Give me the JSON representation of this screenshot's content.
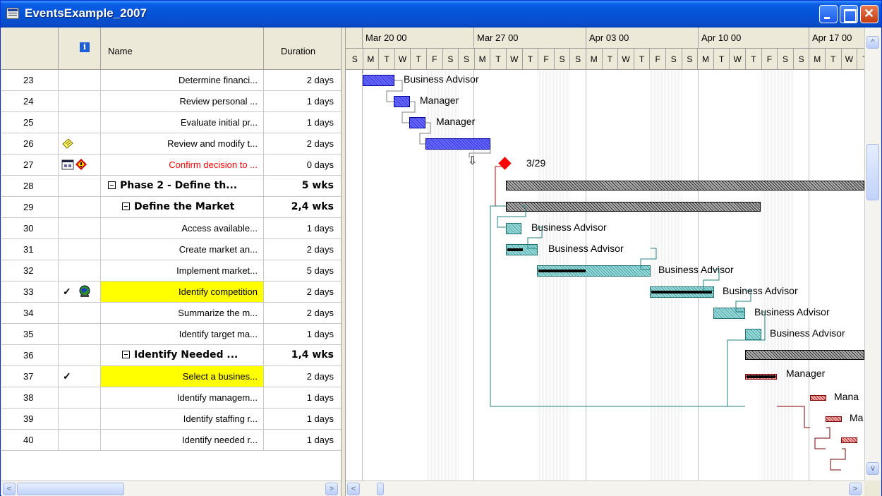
{
  "window": {
    "title": "EventsExample_2007"
  },
  "grid": {
    "headers": {
      "id": "",
      "indicators": "i",
      "name": "Name",
      "duration": "Duration"
    },
    "rows": [
      {
        "id": "23",
        "name": "Determine financi...",
        "duration": "2 days"
      },
      {
        "id": "24",
        "name": "Review personal ...",
        "duration": "1 days"
      },
      {
        "id": "25",
        "name": "Evaluate initial pr...",
        "duration": "1 days"
      },
      {
        "id": "26",
        "name": "Review and modify t...",
        "duration": "2 days",
        "indicator": "note-icon"
      },
      {
        "id": "27",
        "name": "Confirm decision to ...",
        "duration": "0 days",
        "indicator": "calendar-warning-icon",
        "color": "#ff0000"
      },
      {
        "id": "28",
        "name": "Phase 2 - Define th...",
        "duration": "5 wks",
        "summary": true
      },
      {
        "id": "29",
        "name": "Define the Market",
        "duration": "2,4 wks",
        "summary": true
      },
      {
        "id": "30",
        "name": "Access available...",
        "duration": "1 days"
      },
      {
        "id": "31",
        "name": "Create market an...",
        "duration": "2 days"
      },
      {
        "id": "32",
        "name": "Implement market...",
        "duration": "5 days"
      },
      {
        "id": "33",
        "name": "Identify competition",
        "duration": "2 days",
        "highlight": "#ffff00",
        "indicator": "check-globe-icon"
      },
      {
        "id": "34",
        "name": "Summarize the m...",
        "duration": "2 days"
      },
      {
        "id": "35",
        "name": "Identify target ma...",
        "duration": "1 days"
      },
      {
        "id": "36",
        "name": "Identify Needed ...",
        "duration": "1,4 wks",
        "summary": true
      },
      {
        "id": "37",
        "name": "Select a busines...",
        "duration": "2 days",
        "highlight": "#ffff00",
        "indicator": "check-icon"
      },
      {
        "id": "38",
        "name": "Identify managem...",
        "duration": "1 days"
      },
      {
        "id": "39",
        "name": "Identify staffing r...",
        "duration": "1 days"
      },
      {
        "id": "40",
        "name": "Identify needed r...",
        "duration": "1 days"
      }
    ]
  },
  "timeline": {
    "weeks": [
      "Mar 20 00",
      "Mar 27 00",
      "Apr 03 00",
      "Apr 10 00",
      "Apr 17 00"
    ],
    "days": [
      "S",
      "M",
      "T",
      "W",
      "T",
      "F",
      "S"
    ],
    "milestone_label": "3/29"
  },
  "resources": {
    "business_advisor": "Business Advisor",
    "manager": "Manager",
    "mana": "Mana",
    "ma": "Ma"
  },
  "colors": {
    "accent": "#0553d6",
    "highlight": "#ffff00",
    "milestone": "#ff0000"
  }
}
